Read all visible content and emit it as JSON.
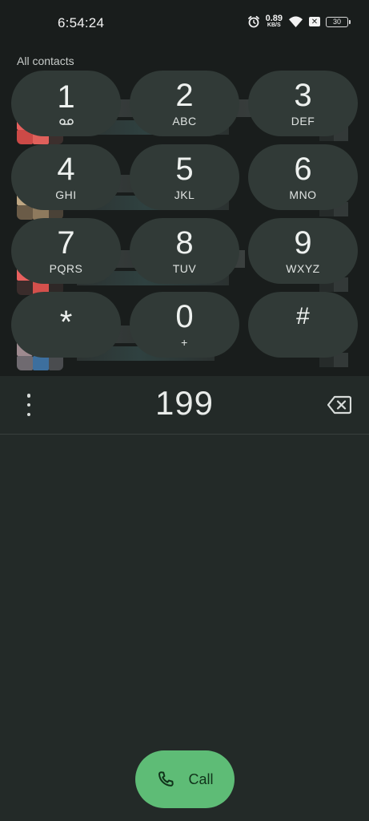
{
  "status_bar": {
    "time": "6:54:24",
    "net_speed_value": "0.89",
    "net_speed_unit": "KB/S",
    "battery": "30",
    "icons": [
      "alarm-icon",
      "net-speed-icon",
      "wifi-icon",
      "x-badge-icon",
      "battery-icon"
    ]
  },
  "contacts": {
    "section_title": "All contacts",
    "rows": [
      {
        "avatar_color": "#e8605e"
      },
      {
        "avatar_color": "#cdb58f"
      },
      {
        "avatar_color": "#e8605e"
      },
      {
        "avatar_color": "#b49aa0"
      }
    ]
  },
  "dialer": {
    "number": "199",
    "menu_icon": "more-vertical-icon",
    "backspace_icon": "backspace-icon",
    "keys": [
      {
        "digit": "1",
        "letters": ""
      },
      {
        "digit": "2",
        "letters": "ABC"
      },
      {
        "digit": "3",
        "letters": "DEF"
      },
      {
        "digit": "4",
        "letters": "GHI"
      },
      {
        "digit": "5",
        "letters": "JKL"
      },
      {
        "digit": "6",
        "letters": "MNO"
      },
      {
        "digit": "7",
        "letters": "PQRS"
      },
      {
        "digit": "8",
        "letters": "TUV"
      },
      {
        "digit": "9",
        "letters": "WXYZ"
      },
      {
        "digit": "*",
        "letters": ""
      },
      {
        "digit": "0",
        "letters": "+"
      },
      {
        "digit": "#",
        "letters": ""
      }
    ],
    "call_label": "Call",
    "call_icon": "phone-icon"
  },
  "colors": {
    "background": "#191d1c",
    "dialpad_panel": "#232a28",
    "key": "#313a37",
    "call_button": "#5ebc76"
  }
}
